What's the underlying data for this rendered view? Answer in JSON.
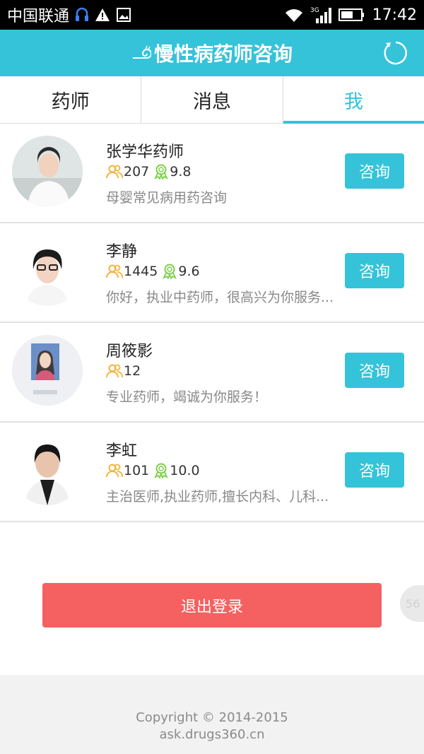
{
  "status_bar": {
    "carrier": "中国联通",
    "network": "3G",
    "time": "17:42"
  },
  "header": {
    "title": "慢性病药师咨询",
    "brand_color": "#35c3d9"
  },
  "tabs": [
    {
      "label": "药师"
    },
    {
      "label": "消息"
    },
    {
      "label": "我",
      "active": true
    }
  ],
  "pharmacists": [
    {
      "name": "张学华药师",
      "consults": "207",
      "rating": "9.8",
      "desc": "母婴常见病用药咨询",
      "button": "咨询"
    },
    {
      "name": "李静",
      "consults": "1445",
      "rating": "9.6",
      "desc": "你好，执业中药师，很高兴为你服务...",
      "button": "咨询"
    },
    {
      "name": "周筱影",
      "consults": "12",
      "rating": "",
      "desc": "专业药师，竭诚为你服务！",
      "button": "咨询"
    },
    {
      "name": "李虹",
      "consults": "101",
      "rating": "10.0",
      "desc": "主治医师,执业药师,擅长内科、儿科...",
      "button": "咨询"
    }
  ],
  "logout": {
    "label": "退出登录",
    "color": "#f56060"
  },
  "side_tab": {
    "label": "56"
  },
  "footer": {
    "copyright": "Copyright © 2014-2015",
    "domain": "ask.drugs360.cn"
  }
}
